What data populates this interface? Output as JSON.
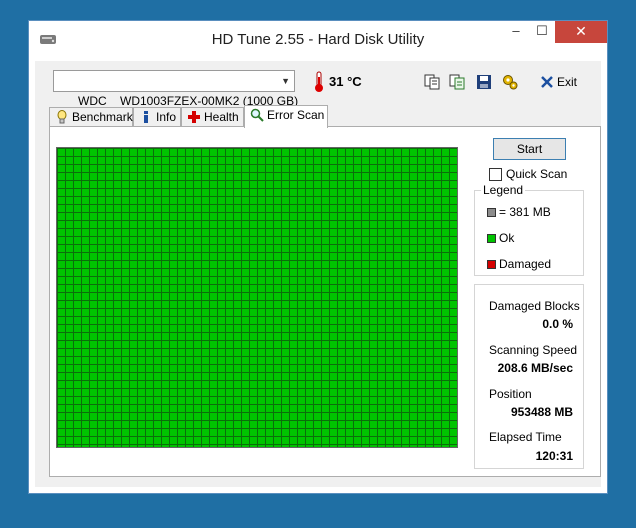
{
  "window": {
    "title": "HD Tune 2.55 - Hard Disk Utility",
    "minimize": "–",
    "maximize": "☐",
    "close": "✕"
  },
  "toolbar": {
    "drive": "WDC    WD1003FZEX-00MK2 (1000 GB)",
    "temperature": "31 °C",
    "exit_label": "Exit",
    "tools": [
      "copy-icon",
      "copy-info-icon",
      "save-icon",
      "options-icon"
    ]
  },
  "tabs": [
    {
      "label": "Benchmark",
      "icon": "benchmark-icon"
    },
    {
      "label": "Info",
      "icon": "info-icon"
    },
    {
      "label": "Health",
      "icon": "health-icon"
    },
    {
      "label": "Error Scan",
      "icon": "error-scan-icon",
      "active": true
    }
  ],
  "scan": {
    "start_label": "Start",
    "quick_scan_label": "Quick Scan",
    "quick_scan_checked": false,
    "block_status": "ok"
  },
  "legend": {
    "title": "Legend",
    "items": [
      {
        "label": "= 381 MB",
        "color": "#8c8c8c"
      },
      {
        "label": "Ok",
        "color": "#00c400"
      },
      {
        "label": "Damaged",
        "color": "#d40000"
      }
    ]
  },
  "stats": {
    "damaged_blocks_label": "Damaged Blocks",
    "damaged_blocks_value": "0.0 %",
    "scanning_speed_label": "Scanning Speed",
    "scanning_speed_value": "208.6 MB/sec",
    "position_label": "Position",
    "position_value": "953488 MB",
    "elapsed_time_label": "Elapsed Time",
    "elapsed_time_value": "120:31"
  },
  "colors": {
    "ok_block": "#00c400",
    "grid_line": "#0b6e0b",
    "close_button": "#c7463c",
    "desktop": "#1f6fa4"
  }
}
